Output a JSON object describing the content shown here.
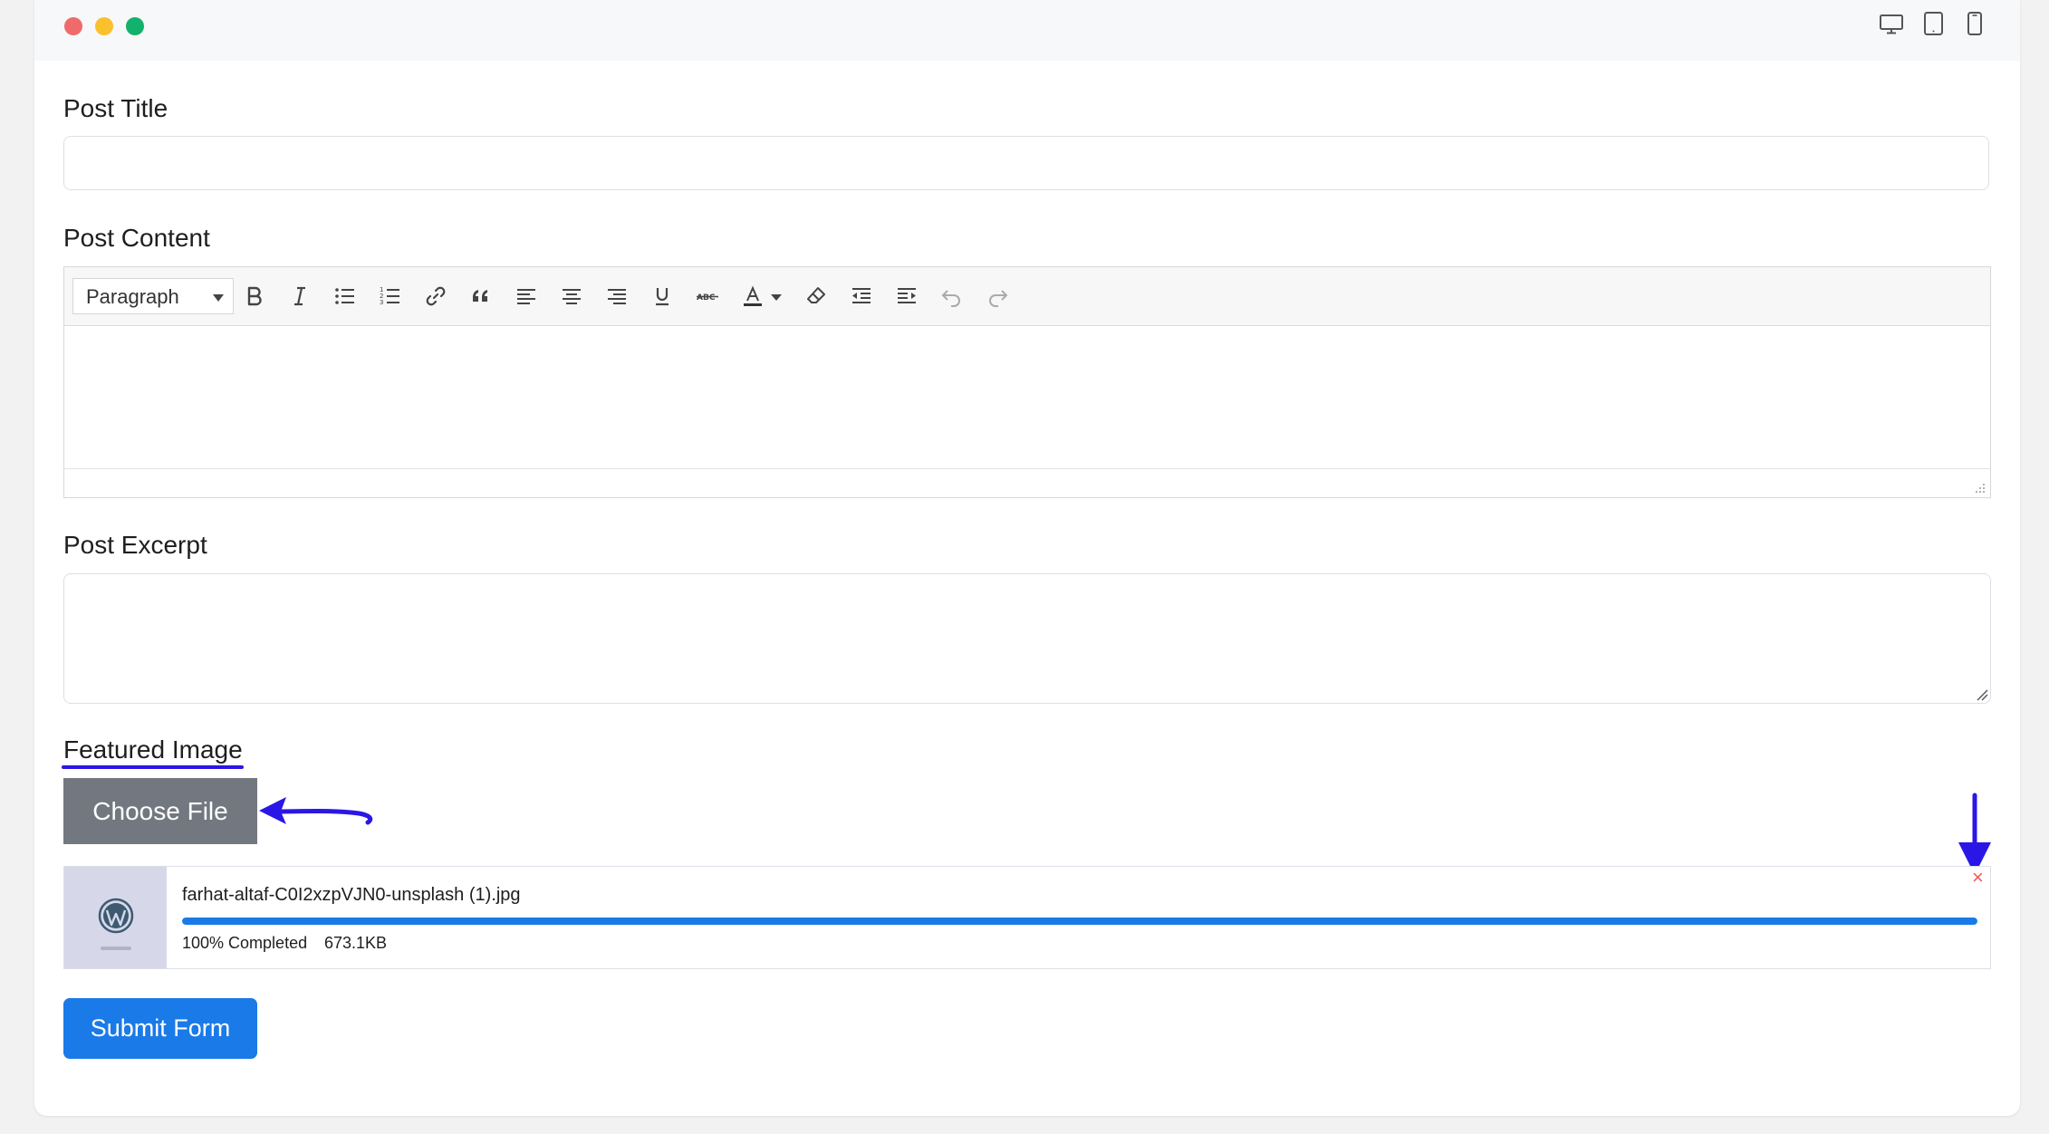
{
  "window": {
    "controls": [
      "close",
      "minimize",
      "maximize"
    ]
  },
  "device_toggles": [
    "desktop-icon",
    "tablet-icon",
    "mobile-icon"
  ],
  "post_title": {
    "label": "Post Title",
    "value": ""
  },
  "post_content": {
    "label": "Post Content",
    "format": "Paragraph",
    "toolbar": [
      "bold-icon",
      "italic-icon",
      "bullet-list-icon",
      "numbered-list-icon",
      "link-icon",
      "blockquote-icon",
      "align-left-icon",
      "align-center-icon",
      "align-right-icon",
      "underline-icon",
      "strikethrough-icon",
      "text-color-icon",
      "clear-formatting-icon",
      "outdent-icon",
      "indent-icon",
      "undo-icon",
      "redo-icon"
    ]
  },
  "post_excerpt": {
    "label": "Post Excerpt",
    "value": ""
  },
  "featured_image": {
    "label": "Featured Image",
    "button": "Choose File",
    "file": {
      "name": "farhat-altaf-C0I2xzpVJN0-unsplash (1).jpg",
      "status": "100% Completed",
      "size": "673.1KB",
      "progress": 1.0,
      "remove": "×"
    }
  },
  "submit": "Submit Form",
  "colors": {
    "accent": "#1a7ae8",
    "annotation": "#2a17e6",
    "remove": "#ee5a5a",
    "button_gray": "#737880"
  }
}
